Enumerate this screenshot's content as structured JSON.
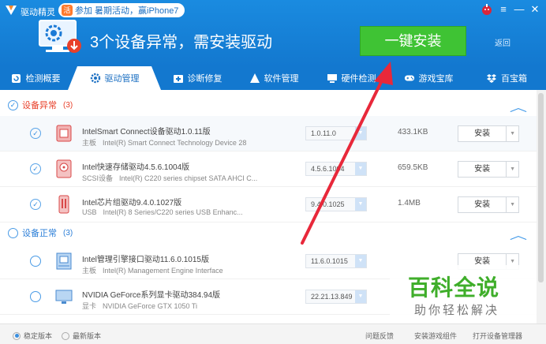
{
  "window": {
    "app_name": "驱动精灵",
    "promo": {
      "badge": "活",
      "text": "参加 暑期活动，赢iPhone7"
    },
    "controls": {
      "menu": "≡",
      "minimize": "—",
      "close": "✕"
    }
  },
  "hero": {
    "title": "3个设备异常，需安装驱动",
    "install_all_label": "一键安装",
    "back_label": "返回"
  },
  "tabs": [
    {
      "label": "检测概要"
    },
    {
      "label": "驱动管理"
    },
    {
      "label": "诊断修复"
    },
    {
      "label": "软件管理"
    },
    {
      "label": "硬件检测"
    },
    {
      "label": "游戏宝库"
    },
    {
      "label": "百宝箱"
    }
  ],
  "groups": {
    "abnormal": {
      "label": "设备异常",
      "count": "(3)",
      "color": "#e8402a"
    },
    "normal": {
      "label": "设备正常",
      "count": "(3)",
      "color": "#2c7fd8"
    }
  },
  "drivers": [
    {
      "name": "IntelSmart Connect设备驱动1.0.11版",
      "category": "主板",
      "device": "Intel(R) Smart Connect Technology Device  28",
      "version": "1.0.11.0",
      "size": "433.1KB",
      "action": "安装",
      "checked": true
    },
    {
      "name": "Intel快速存储驱动4.5.6.1004版",
      "category": "SCSI设备",
      "device": "Intel(R) C220 series chipset SATA AHCI C...",
      "version": "4.5.6.1004",
      "size": "659.5KB",
      "action": "安装",
      "checked": true
    },
    {
      "name": "Intel芯片组驱动9.4.0.1027版",
      "category": "USB",
      "device": "Intel(R) 8 Series/C220 series USB Enhanc...",
      "version": "9.4.0.1025",
      "size": "1.4MB",
      "action": "安装",
      "checked": true
    },
    {
      "name": "Intel管理引擎接口驱动11.6.0.1015版",
      "category": "主板",
      "device": "Intel(R) Management Engine Interface",
      "version": "11.6.0.1015",
      "size": "",
      "action": "安装",
      "checked": false
    },
    {
      "name": "NVIDIA GeForce系列显卡驱动384.94版",
      "category": "显卡",
      "device": "NVIDIA GeForce GTX 1050 Ti",
      "version": "22.21.13.849",
      "size": "",
      "action": "安装",
      "checked": false
    }
  ],
  "footer": {
    "stable_label": "稳定版本",
    "latest_label": "最新版本",
    "feedback_label": "问题反馈",
    "games_label": "安装游戏组件",
    "device_mgr_label": "打开设备管理器"
  },
  "watermark": {
    "main": "百科全说",
    "sub": "助你轻松解决"
  },
  "colors": {
    "header": "#1378cf",
    "install_green": "#3fc334",
    "arrow_red": "#e8283a"
  }
}
